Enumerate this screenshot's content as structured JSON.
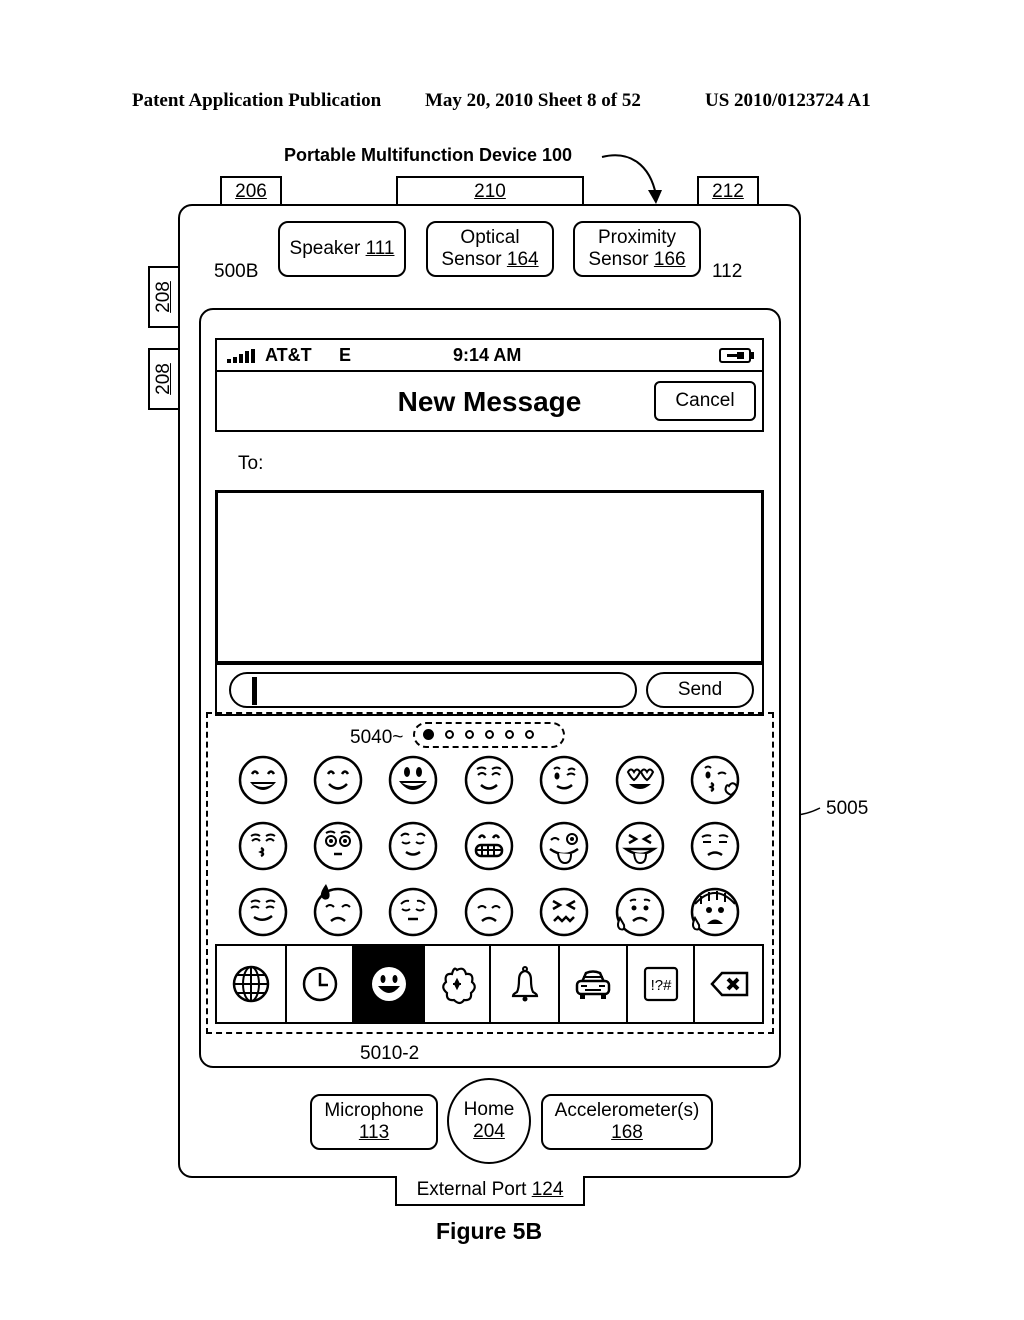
{
  "header": {
    "left": "Patent Application Publication",
    "middle": "May 20, 2010  Sheet 8 of 52",
    "right": "US 2010/0123724 A1"
  },
  "device": {
    "title": "Portable Multifunction Device 100",
    "ref_206": "206",
    "ref_210": "210",
    "ref_212": "212",
    "ref_208a": "208",
    "ref_208b": "208",
    "speaker": {
      "label": "Speaker",
      "ref": "111"
    },
    "optical": {
      "label1": "Optical",
      "label2": "Sensor",
      "ref": "164"
    },
    "proximity": {
      "label1": "Proximity",
      "label2": "Sensor",
      "ref": "166"
    },
    "screen_ref": "500B",
    "touchscreen_ref": "112",
    "microphone": {
      "label": "Microphone",
      "ref": "113"
    },
    "home": {
      "label": "Home",
      "ref": "204"
    },
    "accelerometer": {
      "label": "Accelerometer(s)",
      "ref": "168"
    },
    "external_port": {
      "label": "External Port",
      "ref": "124"
    }
  },
  "screen": {
    "status": {
      "carrier": "AT&T",
      "network": "E",
      "time": "9:14 AM"
    },
    "nav": {
      "title": "New Message",
      "cancel": "Cancel"
    },
    "to_label": "To:",
    "compose": {
      "text": "",
      "send": "Send"
    },
    "keyboard_ref": "5005",
    "page_indicator_ref": "5040",
    "page_indicator": {
      "total": 6,
      "active": 1
    },
    "emoji_rows": [
      [
        "grinning-smiling-eyes",
        "smiling-blush",
        "grinning-big",
        "relieved-smile",
        "winking",
        "heart-eyes",
        "blowing-kiss"
      ],
      [
        "kissing-closed-eyes",
        "flushed",
        "pensive-smile",
        "grimacing",
        "winking-tongue",
        "squinting-tongue",
        "unamused"
      ],
      [
        "smirking",
        "downcast-sweat",
        "pensive",
        "disappointed",
        "confounded",
        "sad-sweat",
        "fearful-screaming"
      ]
    ],
    "category_tabs": [
      "globe",
      "recent-clock",
      "smileys",
      "flower",
      "bell",
      "car",
      "symbols",
      "delete"
    ],
    "selected_tab": "smileys",
    "selected_tab_ref": "5010-2",
    "symbols_label": "!?#"
  },
  "caption": "Figure 5B"
}
